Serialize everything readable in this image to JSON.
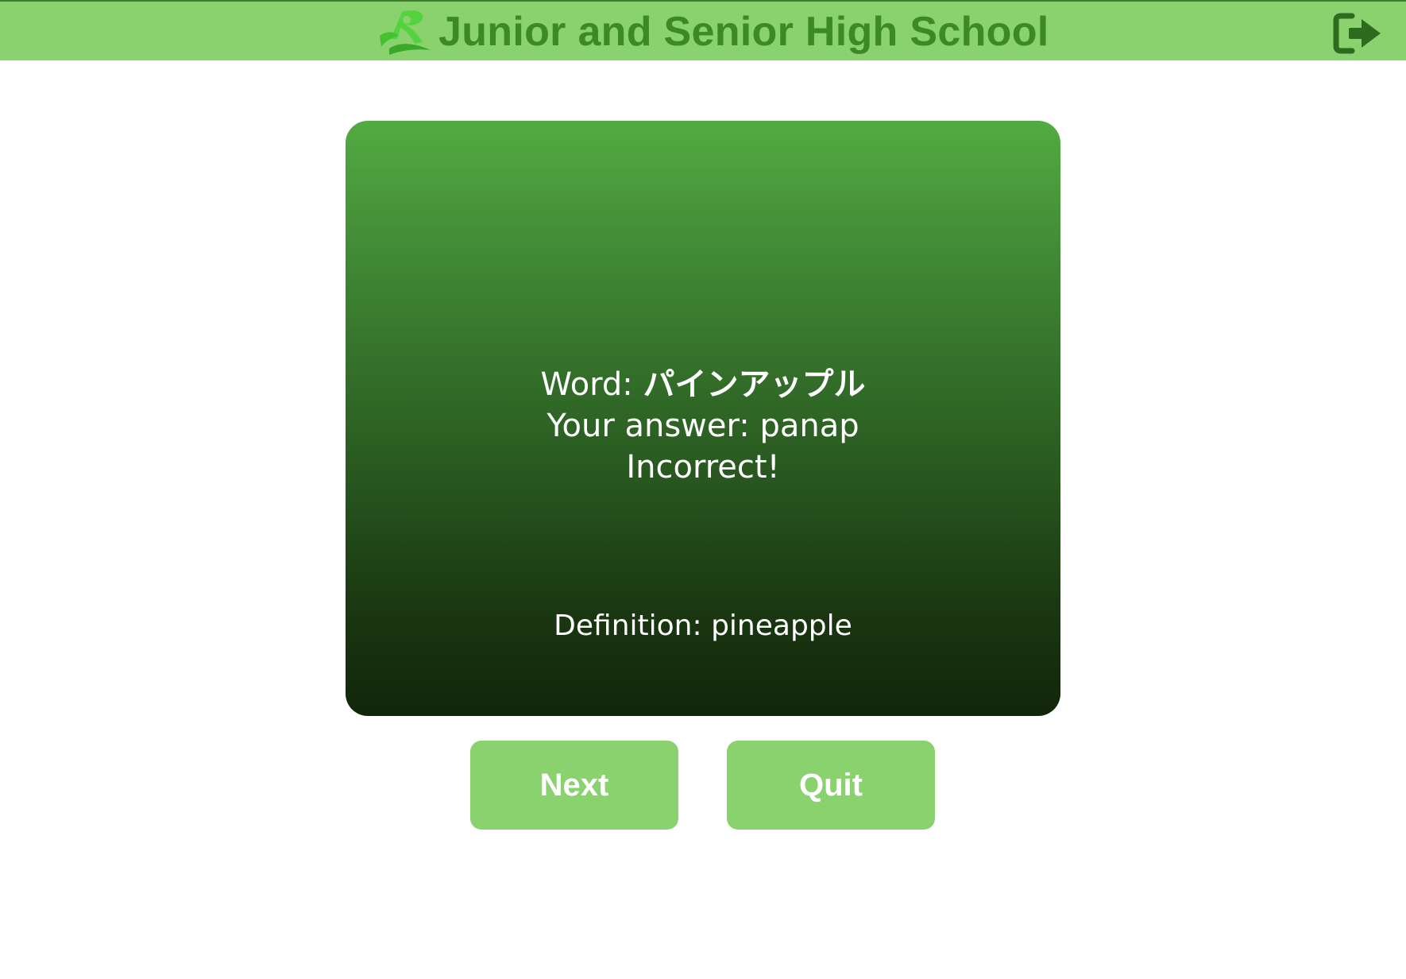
{
  "header": {
    "title": "Junior and Senior High School",
    "logo_icon": "school-logo-icon",
    "logout_icon": "logout-icon"
  },
  "card": {
    "word_label": "Word: ",
    "word_value": "パインアップル",
    "answer_label": "Your answer: ",
    "answer_value": "panap",
    "result": "Incorrect!",
    "definition_label": "Definition: ",
    "definition_value": "pineapple"
  },
  "buttons": {
    "next": "Next",
    "quit": "Quit"
  },
  "colors": {
    "header_bg": "#89d26e",
    "title_text": "#3b8a24",
    "card_top": "#52ab42",
    "card_bottom": "#12250a",
    "button_bg": "#89d26e"
  }
}
